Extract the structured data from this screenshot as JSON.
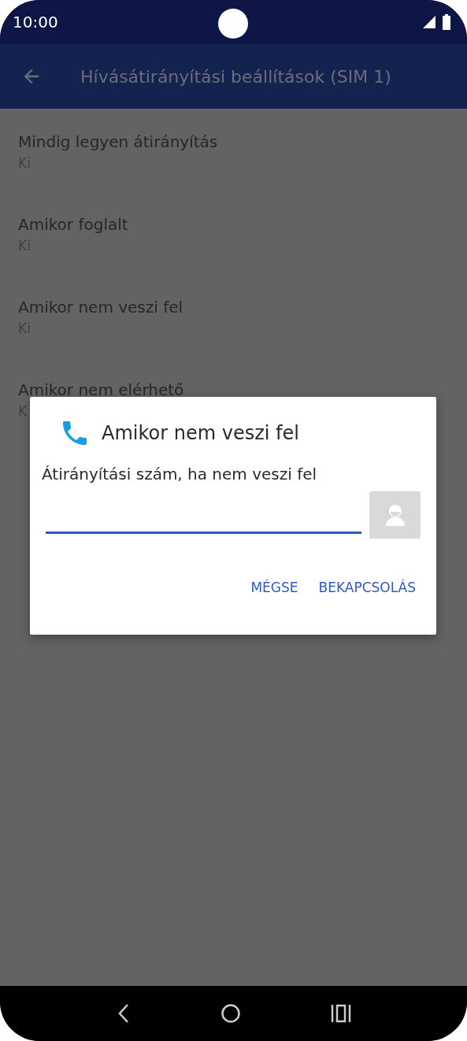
{
  "status_bar": {
    "time": "10:00"
  },
  "app_bar": {
    "title": "Hívásátirányítási beállítások (SIM 1)"
  },
  "settings": [
    {
      "title": "Mindig legyen átirányítás",
      "value": "Ki"
    },
    {
      "title": "Amikor foglalt",
      "value": "Ki"
    },
    {
      "title": "Amikor nem veszi fel",
      "value": "Ki"
    },
    {
      "title": "Amikor nem elérhető",
      "value": "K"
    }
  ],
  "dialog": {
    "title": "Amikor nem veszi fel",
    "label": "Átirányítási szám, ha nem veszi fel",
    "buttons": [
      "MÉGSE",
      "BEKAPCSOLÁS"
    ]
  }
}
